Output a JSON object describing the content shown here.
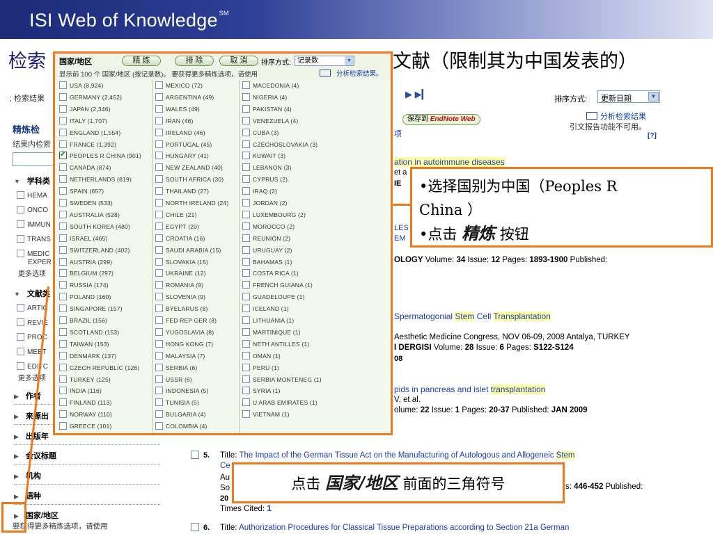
{
  "banner": {
    "title": "ISI Web of Knowledge",
    "tm": "SM"
  },
  "heading": {
    "prefix": "检索",
    "suffix": "文献（限制其为中国发表的）"
  },
  "results": {
    "crumb": "检索结果",
    "nav": "▶ ▶▎",
    "sort_label": "排序方式:",
    "sort_value": "更新日期",
    "save_label": "保存到",
    "endnote_label": "EndNote Web",
    "analyze": "分析检索结果",
    "cite_unavailable": "引文报告功能不可用。",
    "help": "[?]",
    "x_fragment": "项",
    "r1_frag1": "ation in autoimmune diseases",
    "r1_frag2": "et a",
    "r1_frag3": "IE",
    "r1_frag4": "LES",
    "r1_frag5": "EM",
    "r1_frag6": "OLOGY",
    "r1_volume": "34",
    "r1_issue": "12",
    "r1_pages": "1893-1900",
    "r1_published": "Published:",
    "r2_title_plain": "Spermatogonial ",
    "r2_hl1": "Stem",
    "r2_mid": " Cell ",
    "r2_hl2": "Transplantation",
    "r2_conf": "Aesthetic Medicine Congress, NOV 06-09, 2008 Antalya, TURKEY",
    "r2_journal": "I DERGISI",
    "r2_volume": "28",
    "r2_issue": "6",
    "r2_pages": "S122-S124",
    "r2_year": "08",
    "r3_title_a": "pids in pancreas and islet ",
    "r3_hl": "transplantation",
    "r3_authors": "V, et al.",
    "r3_volume": "22",
    "r3_issue": "1",
    "r3_pages": "20-37",
    "r3_published": "Published:",
    "r3_date": "JAN 2009",
    "r5_num": "5.",
    "r5_title_label": "Title:",
    "r5_title": "The Impact of the German Tissue Act on the Manufacturing of Autologous and Allogeneic ",
    "r5_hl": "Stem",
    "r5_title2": "Ce",
    "r5_au": "Au",
    "r5_so": "So",
    "r5_pages_label": "s:",
    "r5_pages": "446-452",
    "r5_published": "Published:",
    "r5_year": "20",
    "r5_cited_label": "Times Cited:",
    "r5_cited": "1",
    "r6_num": "6.",
    "r6_title_label": "Title:",
    "r6_title": "Authorization Procedures for Classical Tissue Preparations according to Section 21a German"
  },
  "left": {
    "refine_title": "精炼检",
    "refine_sub": "结果内检索",
    "subject_label": "学科类",
    "subjects": [
      "HEMA",
      "ONCO",
      "IMMUN",
      "TRANS",
      "MEDIC",
      "EXPER"
    ],
    "more1": "更多选项",
    "doctype_label": "文献类",
    "doctypes": [
      "ARTIC",
      "REVIE",
      "PROC",
      "MEET",
      "EDITC"
    ],
    "more2": "更多选项",
    "sections": [
      "作者",
      "来源出",
      "出版年",
      "会议标题",
      "机构",
      "语种",
      "国家/地区"
    ],
    "footer": "要获得更多精炼选项，请使用"
  },
  "popup": {
    "title": "国家/地区",
    "refine_btn": "精 炼",
    "exclude_btn": "排 除",
    "cancel_btn": "取 消",
    "sort_label": "排序方式:",
    "sort_value": "记录数",
    "info": "显示前 100 个 国家/地区 (按记录数)。 要获得更多精炼选项，请使用",
    "analyze_link": "分析检索结果。",
    "columns": [
      [
        "USA (8,924)",
        "GERMANY (2,452)",
        "JAPAN (2,346)",
        "ITALY (1,707)",
        "ENGLAND (1,554)",
        "FRANCE (1,392)",
        "PEOPLES R CHINA (901)",
        "CANADA (874)",
        "NETHERLANDS (819)",
        "SPAIN (657)",
        "SWEDEN (533)",
        "AUSTRALIA (528)",
        "SOUTH KOREA (480)",
        "ISRAEL (465)",
        "SWITZERLAND (402)",
        "AUSTRIA (299)",
        "BELGIUM (297)",
        "RUSSIA (174)",
        "POLAND (160)",
        "SINGAPORE (157)",
        "BRAZIL (156)",
        "SCOTLAND (153)",
        "TAIWAN (153)",
        "DENMARK (137)",
        "CZECH REPUBLIC (126)",
        "TURKEY (125)",
        "INDIA (116)",
        "FINLAND (113)",
        "NORWAY (110)",
        "GREECE (101)"
      ],
      [
        "MEXICO (72)",
        "ARGENTINA (49)",
        "WALES (49)",
        "IRAN (46)",
        "IRELAND (46)",
        "PORTUGAL (45)",
        "HUNGARY (41)",
        "NEW ZEALAND (40)",
        "SOUTH AFRICA (30)",
        "THAILAND (27)",
        "NORTH IRELAND (24)",
        "CHILE (21)",
        "EGYPT (20)",
        "CROATIA (16)",
        "SAUDI ARABIA (15)",
        "SLOVAKIA (15)",
        "UKRAINE (12)",
        "ROMANIA (9)",
        "SLOVENIA (9)",
        "BYELARUS (8)",
        "FED REP GER (8)",
        "YUGOSLAVIA (8)",
        "HONG KONG (7)",
        "MALAYSIA (7)",
        "SERBIA (6)",
        "USSR (6)",
        "INDONESIA (5)",
        "TUNISIA (5)",
        "BULGARIA (4)",
        "COLOMBIA (4)"
      ],
      [
        "MACEDONIA (4)",
        "NIGERIA (4)",
        "PAKISTAN (4)",
        "VENEZUELA (4)",
        "CUBA (3)",
        "CZECHOSLOVAKIA (3)",
        "KUWAIT (3)",
        "LEBANON (3)",
        "CYPRUS (2)",
        "IRAQ (2)",
        "JORDAN (2)",
        "LUXEMBOURG (2)",
        "MOROCCO (2)",
        "REUNION (2)",
        "URUGUAY (2)",
        "BAHAMAS (1)",
        "COSTA RICA (1)",
        "FRENCH GUIANA (1)",
        "GUADELOUPE (1)",
        "ICELAND (1)",
        "LITHUANIA (1)",
        "MARTINIQUE (1)",
        "NETH ANTILLES (1)",
        "OMAN (1)",
        "PERU (1)",
        "SERBIA MONTENEG (1)",
        "SYRIA (1)",
        "U ARAB EMIRATES (1)",
        "VIETNAM (1)"
      ]
    ],
    "checked": "PEOPLES R CHINA (901)"
  },
  "callout1": {
    "line1": "•选择国别为中国（Peoples R",
    "line2": "China ）",
    "line3a": "•点击 ",
    "line3b": "精炼",
    "line3c": " 按钮"
  },
  "callout2": {
    "a": "点击 ",
    "b": "国家/地区",
    "c": " 前面的三角符号"
  },
  "colors": {
    "accent": "#f07a1a",
    "banner": "#1c2a78",
    "link": "#1a3fa8",
    "highlight": "#ffffa8"
  }
}
